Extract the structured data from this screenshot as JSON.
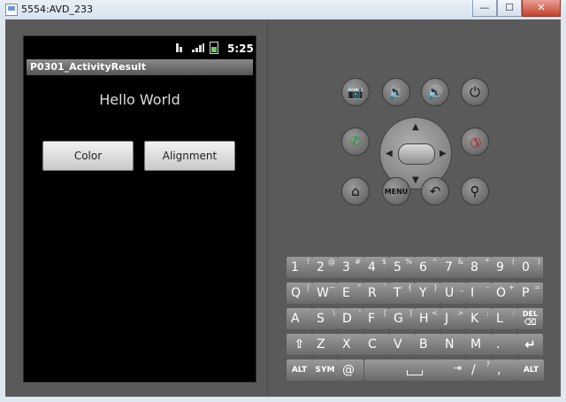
{
  "window": {
    "title": "5554:AVD_233",
    "minimize": "—",
    "maximize": "☐",
    "close": "✕"
  },
  "status": {
    "time": "5:25"
  },
  "app": {
    "title": "P0301_ActivityResult",
    "hello": "Hello World",
    "color_btn": "Color",
    "alignment_btn": "Alignment"
  },
  "controls": {
    "camera": "📷",
    "vol_down": "🔉",
    "vol_up": "🔊",
    "power": "⏻",
    "call": "✆",
    "end_call": "✆",
    "home": "⌂",
    "menu": "MENU",
    "back": "↶",
    "search": "⚲",
    "up": "▲",
    "down": "▼",
    "left": "◀",
    "right": "▶"
  },
  "keyboard": {
    "row1": [
      {
        "m": "1",
        "s": "!"
      },
      {
        "m": "2",
        "s": "@"
      },
      {
        "m": "3",
        "s": "#"
      },
      {
        "m": "4",
        "s": "$"
      },
      {
        "m": "5",
        "s": "%"
      },
      {
        "m": "6",
        "s": "^"
      },
      {
        "m": "7",
        "s": "&"
      },
      {
        "m": "8",
        "s": "*"
      },
      {
        "m": "9",
        "s": "("
      },
      {
        "m": "0",
        "s": ")"
      }
    ],
    "row2": [
      {
        "m": "Q",
        "s": "|"
      },
      {
        "m": "W",
        "s": "~"
      },
      {
        "m": "E",
        "s": "\""
      },
      {
        "m": "R",
        "s": "`"
      },
      {
        "m": "T",
        "s": "{"
      },
      {
        "m": "Y",
        "s": "}"
      },
      {
        "m": "U",
        "s": "_"
      },
      {
        "m": "I",
        "s": "-"
      },
      {
        "m": "O",
        "s": "+"
      },
      {
        "m": "P",
        "s": "="
      }
    ],
    "row3": [
      {
        "m": "A",
        "s": ""
      },
      {
        "m": "S",
        "s": "\\"
      },
      {
        "m": "D",
        "s": "'"
      },
      {
        "m": "F",
        "s": "["
      },
      {
        "m": "G",
        "s": "]"
      },
      {
        "m": "H",
        "s": "<"
      },
      {
        "m": "J",
        "s": ">"
      },
      {
        "m": "K",
        "s": ";"
      },
      {
        "m": "L",
        "s": ":"
      }
    ],
    "del": "DEL",
    "row4": [
      {
        "m": "Z",
        "s": ""
      },
      {
        "m": "X",
        "s": ""
      },
      {
        "m": "C",
        "s": ""
      },
      {
        "m": "V",
        "s": ""
      },
      {
        "m": "B",
        "s": ""
      },
      {
        "m": "N",
        "s": ""
      },
      {
        "m": "M",
        "s": ""
      },
      {
        "m": ".",
        "s": ""
      }
    ],
    "shift": "⇧",
    "enter": "↵",
    "alt": "ALT",
    "sym": "SYM",
    "at": "@",
    "slash": "/",
    "slash_alt": "?",
    "comma": ",",
    "tab": "⇥"
  }
}
